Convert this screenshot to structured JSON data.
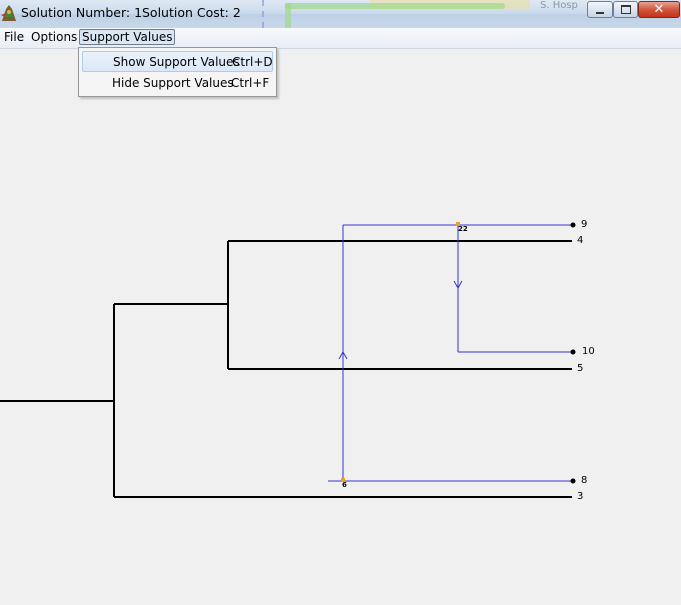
{
  "window": {
    "solution_number": "Solution Number: 1",
    "solution_cost": "Solution Cost: 2",
    "background_text": "S. Hosp"
  },
  "menu": {
    "file": "File",
    "options": "Options",
    "support_values": "Support Values"
  },
  "dropdown": {
    "items": [
      {
        "label": "Show Support Values",
        "accelerator": "Ctrl+D"
      },
      {
        "label": "Hide Support Values",
        "accelerator": "Ctrl+F"
      }
    ]
  },
  "tree": {
    "leaves": [
      {
        "id": "9",
        "label": "9",
        "type": "transfer"
      },
      {
        "id": "4",
        "label": "4",
        "type": "species"
      },
      {
        "id": "10",
        "label": "10",
        "type": "transfer"
      },
      {
        "id": "5",
        "label": "5",
        "type": "species"
      },
      {
        "id": "8",
        "label": "8",
        "type": "transfer"
      },
      {
        "id": "3",
        "label": "3",
        "type": "species"
      }
    ],
    "support_values": [
      "22",
      "6"
    ]
  },
  "colors": {
    "species_tree": "#000000",
    "transfer_edge": "#3535d0",
    "support_marker": "#f0a020",
    "background": "#f0f0f0"
  }
}
